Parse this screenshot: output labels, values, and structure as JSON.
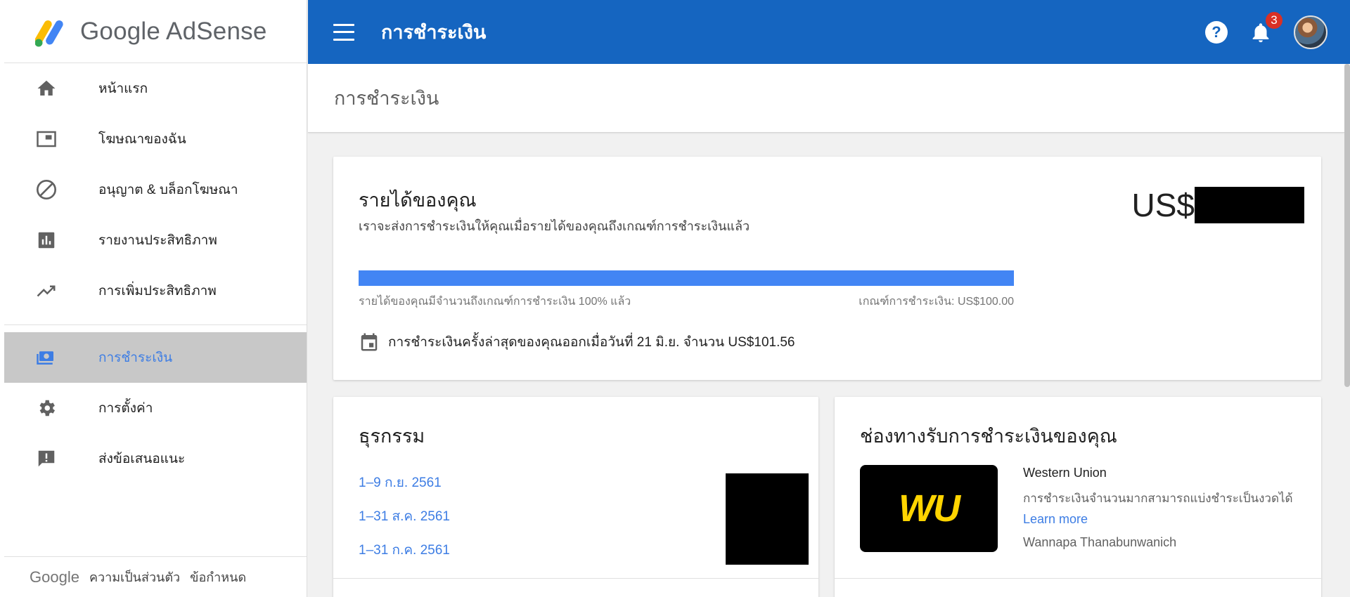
{
  "app": {
    "logo_text": "Google AdSense"
  },
  "sidebar": {
    "items": [
      {
        "label": "หน้าแรก",
        "icon": "home-icon"
      },
      {
        "label": "โฆษณาของฉัน",
        "icon": "ad-unit-icon"
      },
      {
        "label": "อนุญาต & บล็อกโฆษณา",
        "icon": "block-icon"
      },
      {
        "label": "รายงานประสิทธิภาพ",
        "icon": "bar-chart-icon"
      },
      {
        "label": "การเพิ่มประสิทธิภาพ",
        "icon": "trending-up-icon"
      },
      {
        "label": "การชำระเงิน",
        "icon": "payments-icon",
        "active": true
      },
      {
        "label": "การตั้งค่า",
        "icon": "gear-icon"
      },
      {
        "label": "ส่งข้อเสนอแนะ",
        "icon": "feedback-icon"
      }
    ],
    "footer": {
      "brand": "Google",
      "privacy": "ความเป็นส่วนตัว",
      "terms": "ข้อกำหนด"
    }
  },
  "topbar": {
    "title": "การชำระเงิน",
    "help_glyph": "?",
    "notification_count": "3"
  },
  "page": {
    "heading": "การชำระเงิน"
  },
  "earnings": {
    "title": "รายได้ของคุณ",
    "subtitle": "เราจะส่งการชำระเงินให้คุณเมื่อรายได้ของคุณถึงเกณฑ์การชำระเงินแล้ว",
    "currency": "US$",
    "progress_percent": 100,
    "progress_text": "รายได้ของคุณมีจำนวนถึงเกณฑ์การชำระเงิน 100% แล้ว",
    "threshold_text": "เกณฑ์การชำระเงิน: US$100.00",
    "last_payment": "การชำระเงินครั้งล่าสุดของคุณออกเมื่อวันที่ 21 มิ.ย. จำนวน US$101.56"
  },
  "transactions": {
    "title": "ธุรกรรม",
    "items": [
      "1–9 ก.ย. 2561",
      "1–31 ส.ค. 2561",
      "1–31 ก.ค. 2561"
    ]
  },
  "payment_methods": {
    "title": "ช่องทางรับการชำระเงินของคุณ",
    "logo_text": "WU",
    "method_name": "Western Union",
    "description": "การชำระเงินจำนวนมากสามารถแบ่งชำระเป็นงวดได้",
    "learn_more": "Learn more",
    "account_holder": "Wannapa Thanabunwanich"
  },
  "colors": {
    "topbar": "#1565c0",
    "link": "#3d7de4",
    "progress": "#4285f4",
    "active_bg": "#c8c8c8",
    "wu_yellow": "#ffd400"
  }
}
